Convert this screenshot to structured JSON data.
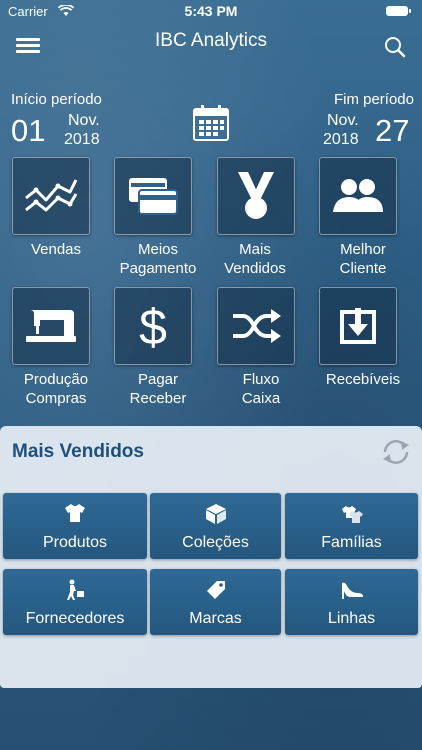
{
  "status_bar": {
    "carrier": "Carrier",
    "time": "5:43 PM"
  },
  "nav": {
    "title": "IBC Analytics",
    "icons": {
      "menu": "hamburger-menu-icon",
      "search": "search-icon"
    }
  },
  "period": {
    "start": {
      "label": "Início período",
      "day": "01",
      "month": "Nov.",
      "year": "2018"
    },
    "end": {
      "label": "Fim período",
      "day": "27",
      "month": "Nov.",
      "year": "2018"
    },
    "calendar_icon": "calendar-icon"
  },
  "tiles": [
    {
      "label1": "Vendas",
      "label2": "",
      "icon": "line-chart-icon"
    },
    {
      "label1": "Meios",
      "label2": "Pagamento",
      "icon": "credit-cards-icon"
    },
    {
      "label1": "Mais",
      "label2": "Vendidos",
      "icon": "medal-icon"
    },
    {
      "label1": "Melhor",
      "label2": "Cliente",
      "icon": "users-icon"
    },
    {
      "label1": "Produção",
      "label2": "Compras",
      "icon": "sewing-machine-icon"
    },
    {
      "label1": "Pagar",
      "label2": "Receber",
      "icon": "dollar-icon"
    },
    {
      "label1": "Fluxo",
      "label2": "Caixa",
      "icon": "shuffle-icon"
    },
    {
      "label1": "Recebíveis",
      "label2": "",
      "icon": "download-tray-icon"
    }
  ],
  "panel": {
    "title": "Mais Vendidos",
    "refresh_icon": "refresh-icon",
    "categories": [
      {
        "label": "Produtos",
        "icon": "tshirt-icon"
      },
      {
        "label": "Coleções",
        "icon": "cube-icon"
      },
      {
        "label": "Famílias",
        "icon": "clothes-icon"
      },
      {
        "label": "Fornecedores",
        "icon": "delivery-person-icon"
      },
      {
        "label": "Marcas",
        "icon": "tag-icon"
      },
      {
        "label": "Linhas",
        "icon": "high-heel-icon"
      }
    ]
  },
  "colors": {
    "background": "#2f6189",
    "panel": "#e6eef5",
    "panel_title": "#1f4f7d",
    "button": "#2a5e88"
  }
}
